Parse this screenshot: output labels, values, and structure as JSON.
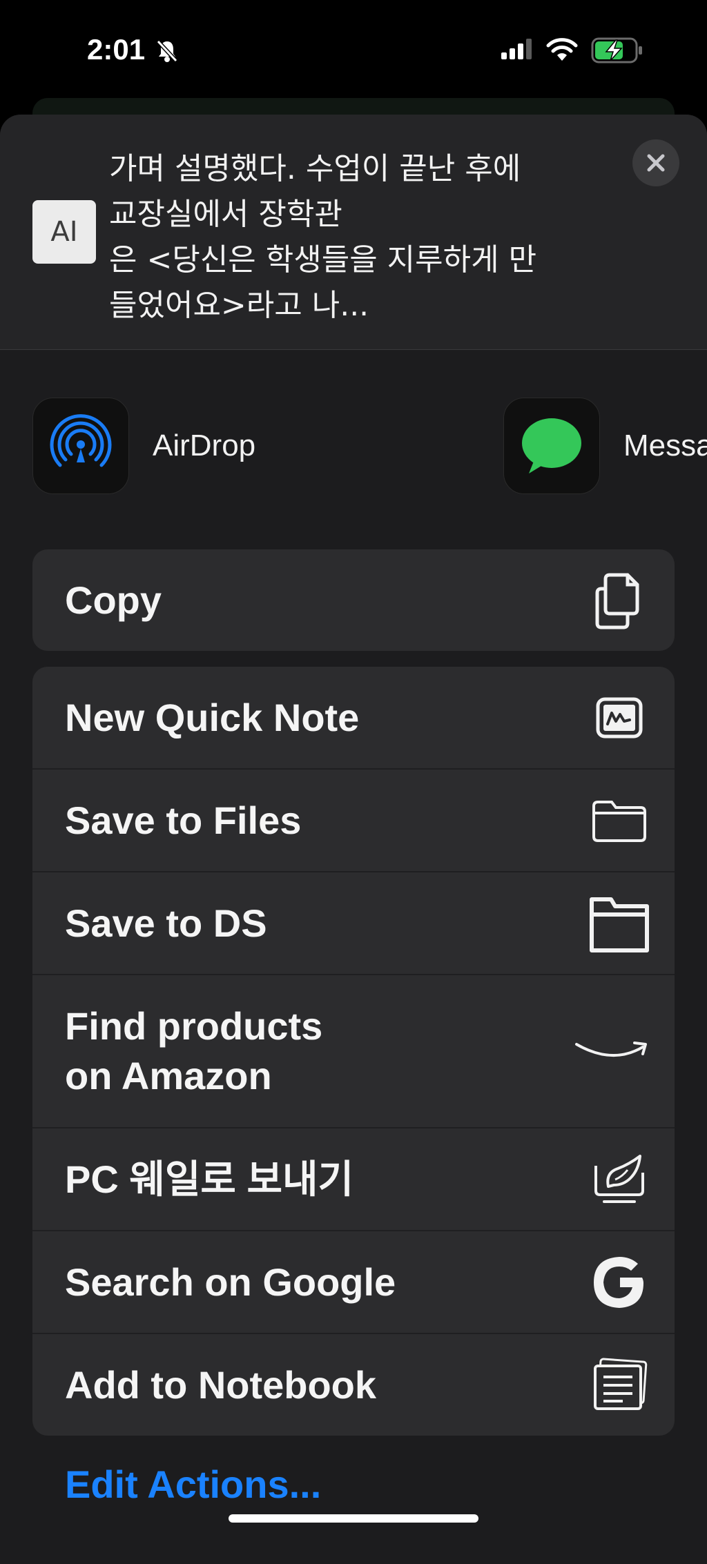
{
  "status_bar": {
    "time": "2:01"
  },
  "preview": {
    "text": "가며 설명했다. 수업이 끝난 후에\n교장실에서 장학관\n은 <당신은 학생들을 지루하게 만\n들었어요>라고 나...",
    "icon_glyph": "AI"
  },
  "share_apps": [
    {
      "label": "AirDrop",
      "icon": "airdrop-icon"
    },
    {
      "label": "Messages",
      "icon": "messages-icon"
    }
  ],
  "actions_group1": [
    {
      "label": "Copy",
      "icon": "copy-icon"
    }
  ],
  "actions_group2": [
    {
      "label": "New Quick Note",
      "icon": "quick-note-icon"
    },
    {
      "label": "Save to Files",
      "icon": "folder-icon"
    },
    {
      "label": "Save to DS",
      "icon": "folder-ds-icon"
    },
    {
      "label": "Find products\non Amazon",
      "icon": "amazon-icon"
    },
    {
      "label": "PC 웨일로 보내기",
      "icon": "whale-icon"
    },
    {
      "label": "Search on Google",
      "icon": "google-icon"
    },
    {
      "label": "Add to Notebook",
      "icon": "notebook-icon"
    }
  ],
  "edit_actions": "Edit Actions...",
  "colors": {
    "accent": "#1a82ff",
    "battery_green": "#34c759",
    "messages_green": "#34c759",
    "airdrop_blue": "#1a7cf5"
  }
}
